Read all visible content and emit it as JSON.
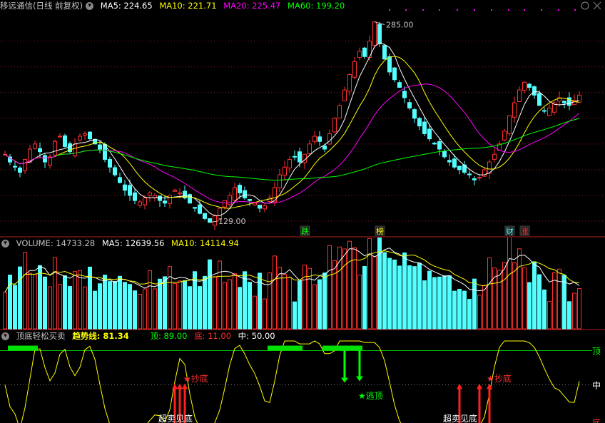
{
  "main": {
    "title": "移远通信(日线 前复权)",
    "ma5": "MA5: 224.65",
    "ma10": "MA10: 221.71",
    "ma20": "MA20: 225.47",
    "ma60": "MA60: 199.20",
    "high_label": "285.00",
    "low_label": "129.00",
    "events": [
      "跌",
      "榜",
      "财",
      "涨"
    ],
    "colors": {
      "ma5": "#ffffff",
      "ma10": "#ffff00",
      "ma20": "#ff00ff",
      "ma60": "#00ff00",
      "up": "#ff3030",
      "down": "#54ffff"
    }
  },
  "volume": {
    "title": "VOLUME: 14733.28",
    "ma5": "MA5: 12639.56",
    "ma10": "MA10: 14114.94"
  },
  "indicator": {
    "title": "顶底轻松买卖",
    "trend": "趋势线: 81.34",
    "top": "顶: 89.00",
    "bottom": "底: 11.00",
    "mid": "中: 50.00",
    "right_top": "顶",
    "right_mid": "中",
    "right_bottom": "底",
    "buy1": "★抄底",
    "buy2": "★抄底",
    "sell": "★逃顶",
    "oversold1": "超卖见底",
    "oversold2": "超卖见底"
  },
  "chart_data": {
    "type": "candlestick",
    "price_axis_marks": {
      "high": 285.0,
      "low": 129.0
    },
    "moving_averages": {
      "MA5": 224.65,
      "MA10": 221.71,
      "MA20": 225.47,
      "MA60": 199.2
    },
    "volume": {
      "last": 14733.28,
      "MA5": 12639.56,
      "MA10": 14114.94
    },
    "indicator": {
      "trend": 81.34,
      "top": 89.0,
      "bottom": 11.0,
      "mid": 50.0
    },
    "close_series": [
      182,
      176,
      172,
      168,
      178,
      186,
      190,
      184,
      176,
      180,
      192,
      196,
      188,
      184,
      190,
      196,
      198,
      194,
      190,
      186,
      178,
      172,
      166,
      160,
      154,
      150,
      146,
      145,
      148,
      152,
      150,
      146,
      144,
      150,
      154,
      152,
      148,
      144,
      140,
      136,
      132,
      129,
      134,
      140,
      146,
      150,
      156,
      152,
      148,
      146,
      144,
      140,
      142,
      148,
      156,
      166,
      172,
      178,
      180,
      176,
      182,
      190,
      196,
      192,
      186,
      198,
      210,
      220,
      232,
      244,
      254,
      262,
      258,
      270,
      285,
      268,
      256,
      246,
      240,
      234,
      226,
      218,
      210,
      204,
      198,
      194,
      190,
      186,
      180,
      176,
      172,
      170,
      168,
      166,
      162,
      164,
      170,
      176,
      182,
      190,
      200,
      212,
      222,
      232,
      238,
      234,
      228,
      220,
      216,
      218,
      222,
      226,
      222,
      220,
      224,
      228
    ]
  }
}
